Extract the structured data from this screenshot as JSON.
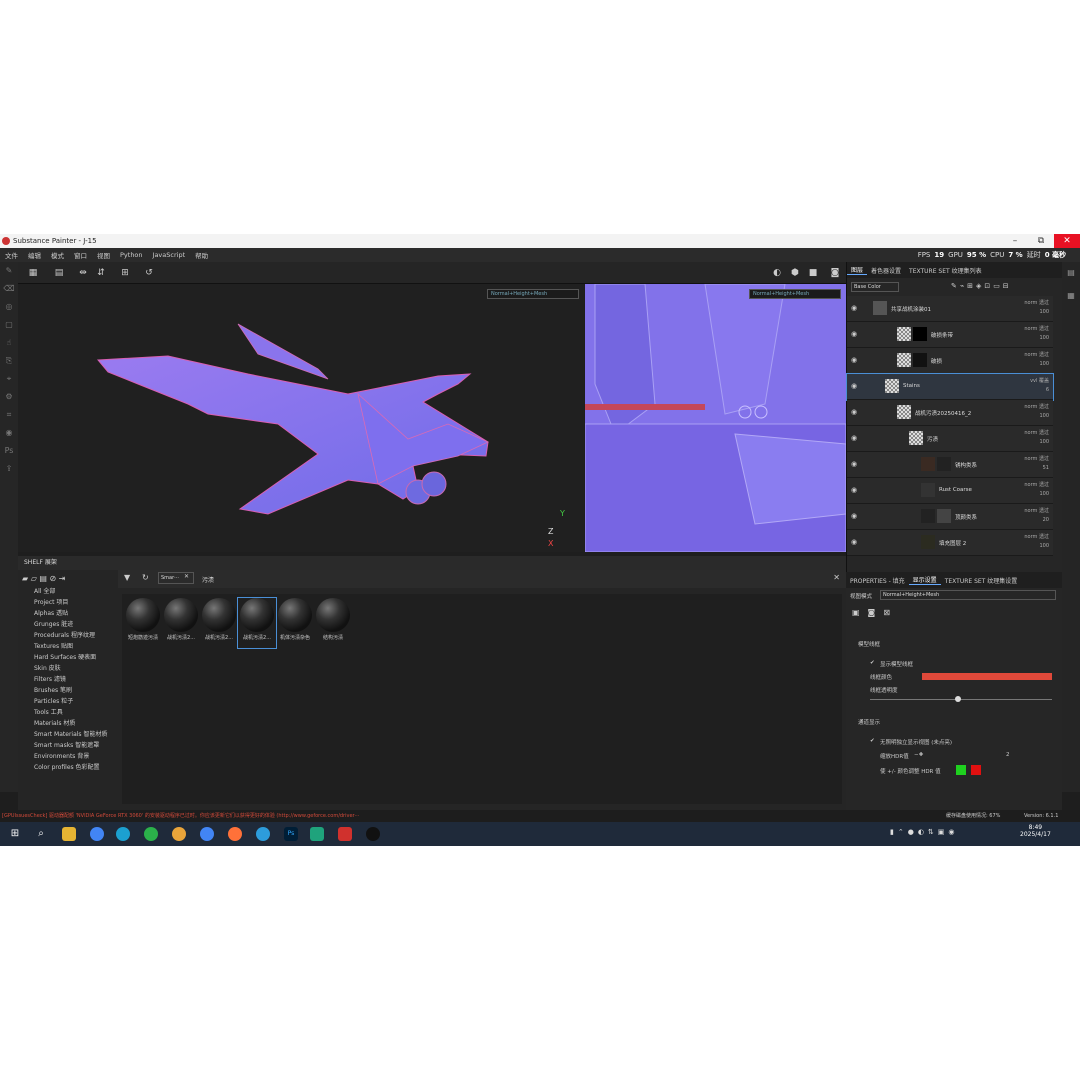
{
  "window": {
    "title": "Substance Painter - J-15",
    "minimize": "–",
    "restore": "⧉",
    "close": "✕"
  },
  "menu": [
    "文件",
    "编辑",
    "模式",
    "窗口",
    "视图",
    "Python",
    "JavaScript",
    "帮助"
  ],
  "stats": {
    "fps_label": "FPS",
    "fps": "19",
    "gpu_label": "GPU",
    "gpu": "95 %",
    "cpu_label": "CPU",
    "cpu": "7 %",
    "latency_label": "延时",
    "latency": "0 毫秒"
  },
  "viewport": {
    "mode_3d": "Normal+Height+Mesh",
    "mode_2d": "Normal+Height+Mesh"
  },
  "shelf": {
    "title": "SHELF 展架",
    "search_tag": "Smar···",
    "search_text": "污渍",
    "categories": [
      "All 全部",
      "Project 项目",
      "Alphas 透贴",
      "Grunges 脏迹",
      "Procedurals 程序纹理",
      "Textures 贴图",
      "Hard Surfaces 硬表面",
      "Skin 皮肤",
      "Filters 滤镜",
      "Brushes 笔刷",
      "Particles 粒子",
      "Tools 工具",
      "Materials 材质",
      "Smart Materials 智能材质",
      "Smart masks 智能遮罩",
      "Environments 背景",
      "Color profiles 色彩配置"
    ],
    "items": [
      "短炮筋迹污渍",
      "战机污渍2...",
      "战机污渍2...",
      "战机污渍2...",
      "机体污渍杂色",
      "结构污渍"
    ]
  },
  "layers_panel": {
    "tabs": [
      "图层",
      "着色器设置",
      "TEXTURE SET 纹理集列表"
    ],
    "channel": "Base Color",
    "layers": [
      {
        "name": "共享战机涂装01",
        "blend": "norm 透过",
        "opacity": "100"
      },
      {
        "name": "破损条带",
        "blend": "norm 透过",
        "opacity": "100"
      },
      {
        "name": "破损",
        "blend": "norm 透过",
        "opacity": "100"
      },
      {
        "name": "Stains",
        "blend": "vvl 覆盖",
        "opacity": "6"
      },
      {
        "name": "战机污渍20250416_2",
        "blend": "norm 透过",
        "opacity": "100"
      },
      {
        "name": "污渍",
        "blend": "norm 透过",
        "opacity": "100"
      },
      {
        "name": "锈构类系",
        "blend": "norm 透过",
        "opacity": "51"
      },
      {
        "name": "Rust Coarse",
        "blend": "norm 透过",
        "opacity": "100"
      },
      {
        "name": "顶颜类系",
        "blend": "norm 透过",
        "opacity": "20"
      },
      {
        "name": "填充图层 2",
        "blend": "norm 透过",
        "opacity": "100"
      }
    ]
  },
  "properties": {
    "tabs": [
      "PROPERTIES - 填充",
      "显示设置",
      "TEXTURE SET 纹理集设置"
    ],
    "view_mode_label": "视图模式",
    "view_mode": "Normal+Height+Mesh",
    "wireframe_section": "模型线框",
    "show_wireframe": "显示模型线框",
    "wire_color_label": "线框颜色",
    "wire_color": "#e0493a",
    "wire_opacity_label": "线框透明度",
    "overlay_section": "通道显示",
    "isolate_label": "无照明独立显示视图 (未点亮)",
    "hdr_label": "缩放HDR值",
    "hdr_value": "2",
    "color_adjust_label": "使 +/- 颜色调整 HDR 值",
    "swatch_green": "#1fd11f",
    "swatch_red": "#e01010"
  },
  "status": {
    "warning": "[GPUIssuesCheck] 驱动器配额 'NVIDIA GeForce RTX 3060' 的安装驱动程序已过时。你应该更新它们以获得更好的体验 (http://www.geforce.com/driver···",
    "cache": "缓存磁盘使用情况: 67%",
    "version": "Version: 6.1.1"
  },
  "taskbar": {
    "time": "8:49",
    "date": "2025/4/17"
  }
}
